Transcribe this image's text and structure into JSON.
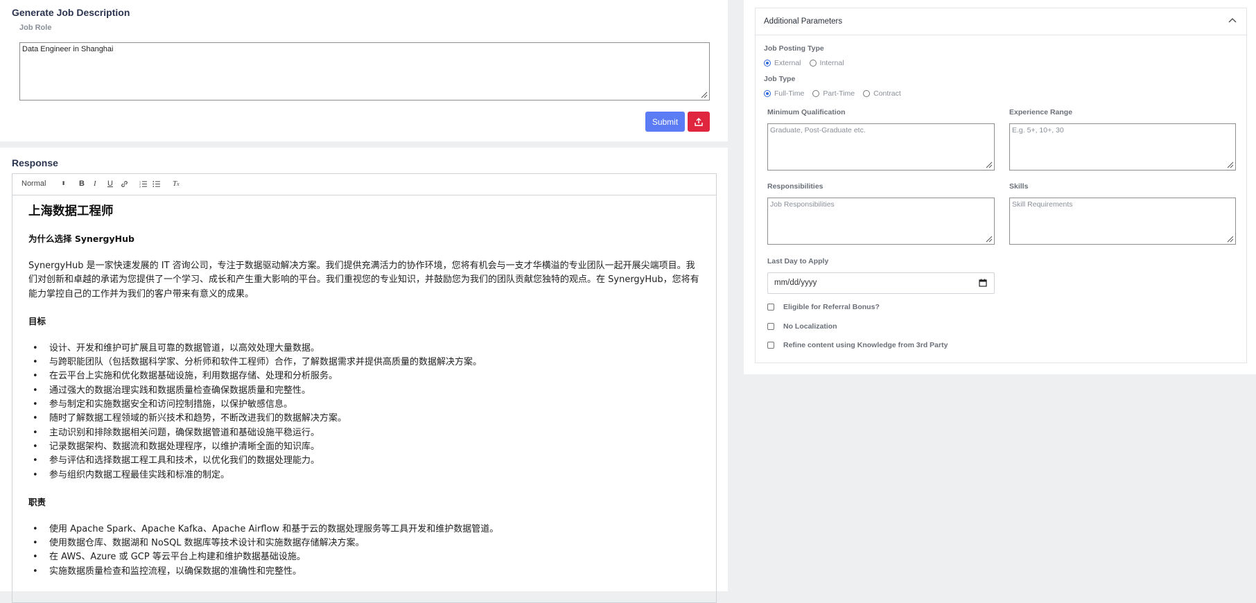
{
  "generate": {
    "title": "Generate Job Description",
    "job_role_label": "Job Role",
    "job_role_value": "Data Engineer in Shanghai",
    "submit_label": "Submit"
  },
  "response": {
    "title": "Response",
    "toolbar": {
      "format_select": "Normal",
      "buttons": [
        "bold-icon",
        "italic-icon",
        "underline-icon",
        "link-icon",
        "ordered-list-icon",
        "bullet-list-icon",
        "clear-format-icon"
      ]
    },
    "heading": "上海数据工程师",
    "why_title": "为什么选择 SynergyHub",
    "why_text": "SynergyHub 是一家快速发展的 IT 咨询公司，专注于数据驱动解决方案。我们提供充满活力的协作环境，您将有机会与一支才华横溢的专业团队一起开展尖端项目。我们对创新和卓越的承诺为您提供了一个学习、成长和产生重大影响的平台。我们重视您的专业知识，并鼓励您为我们的团队贡献您独特的观点。在 SynergyHub，您将有能力掌控自己的工作并为我们的客户带来有意义的成果。",
    "goals_title": "目标",
    "goals": [
      "设计、开发和维护可扩展且可靠的数据管道，以高效处理大量数据。",
      "与跨职能团队（包括数据科学家、分析师和软件工程师）合作，了解数据需求并提供高质量的数据解决方案。",
      "在云平台上实施和优化数据基础设施，利用数据存储、处理和分析服务。",
      "通过强大的数据治理实践和数据质量检查确保数据质量和完整性。",
      "参与制定和实施数据安全和访问控制措施，以保护敏感信息。",
      "随时了解数据工程领域的新兴技术和趋势，不断改进我们的数据解决方案。",
      "主动识别和排除数据相关问题，确保数据管道和基础设施平稳运行。",
      "记录数据架构、数据流和数据处理程序，以维护清晰全面的知识库。",
      "参与评估和选择数据工程工具和技术，以优化我们的数据处理能力。",
      "参与组织内数据工程最佳实践和标准的制定。"
    ],
    "duties_title": "职责",
    "duties": [
      "使用 Apache Spark、Apache Kafka、Apache Airflow 和基于云的数据处理服务等工具开发和维护数据管道。",
      "使用数据仓库、数据湖和 NoSQL 数据库等技术设计和实施数据存储解决方案。",
      "在 AWS、Azure 或 GCP 等云平台上构建和维护数据基础设施。",
      "实施数据质量检查和监控流程，以确保数据的准确性和完整性。"
    ]
  },
  "params": {
    "title": "Additional Parameters",
    "posting_type_label": "Job Posting Type",
    "posting_types": [
      "External",
      "Internal"
    ],
    "posting_type_selected": "External",
    "job_type_label": "Job Type",
    "job_types": [
      "Full-Time",
      "Part-Time",
      "Contract"
    ],
    "job_type_selected": "Full-Time",
    "min_qual_label": "Minimum Qualification",
    "min_qual_placeholder": "Graduate, Post-Graduate etc.",
    "exp_label": "Experience Range",
    "exp_placeholder": "E.g. 5+, 10+, 30",
    "resp_label": "Responsibilities",
    "resp_placeholder": "Job Responsibilities",
    "skills_label": "Skills",
    "skills_placeholder": "Skill Requirements",
    "last_day_label": "Last Day to Apply",
    "last_day_placeholder": "mm/dd/yyyy",
    "referral_label": "Eligible for Referral Bonus?",
    "no_localization_label": "No Localization",
    "refine_label": "Refine content using Knowledge from 3rd Party"
  }
}
